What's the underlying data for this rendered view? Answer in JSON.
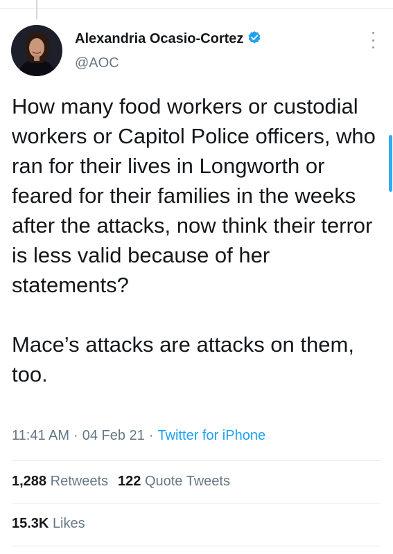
{
  "author": {
    "name": "Alexandria Ocasio-Cortez",
    "handle": "@AOC",
    "verified_icon": "verified-badge-icon"
  },
  "tweet": {
    "paragraphs": [
      "How many food workers or custodial workers or Capitol Police officers, who ran for their lives in Longworth or feared for their families in the weeks after the attacks, now think their terror is less valid because of her statements?",
      "Mace’s attacks are attacks on them, too."
    ],
    "time": "11:41 AM",
    "date": "04 Feb 21",
    "separator": "·",
    "source": "Twitter for iPhone"
  },
  "stats": {
    "retweets_count": "1,288",
    "retweets_label": "Retweets",
    "quotes_count": "122",
    "quotes_label": "Quote Tweets",
    "likes_count": "15.3K",
    "likes_label": "Likes"
  },
  "colors": {
    "accent": "#1da1f2",
    "text": "#14171a",
    "muted": "#657786"
  }
}
